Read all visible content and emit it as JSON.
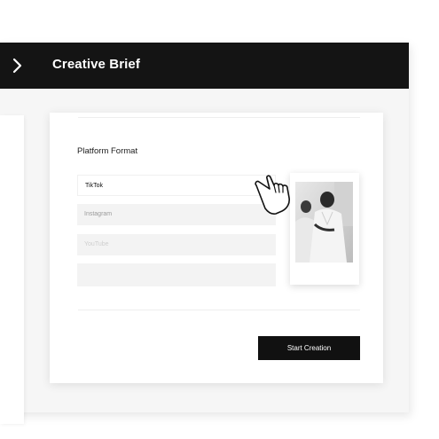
{
  "header": {
    "title": "Creative Brief",
    "nav_icon": "chevron-right-icon"
  },
  "form": {
    "section_title": "Platform Format",
    "options": [
      {
        "label": "TikTok",
        "state": "selected"
      },
      {
        "label": "Instagram",
        "state": "default"
      },
      {
        "label": "YouTube",
        "state": "faded"
      },
      {
        "label": "",
        "state": "empty"
      }
    ]
  },
  "preview": {
    "image_subject": "photo of two people in white lab coats"
  },
  "actions": {
    "start_label": "Start Creation"
  },
  "colors": {
    "header_bg": "#141414",
    "button_bg": "#111111",
    "field_bg": "#f3f3f3"
  },
  "cursor_icon": "hand-pointer-icon"
}
